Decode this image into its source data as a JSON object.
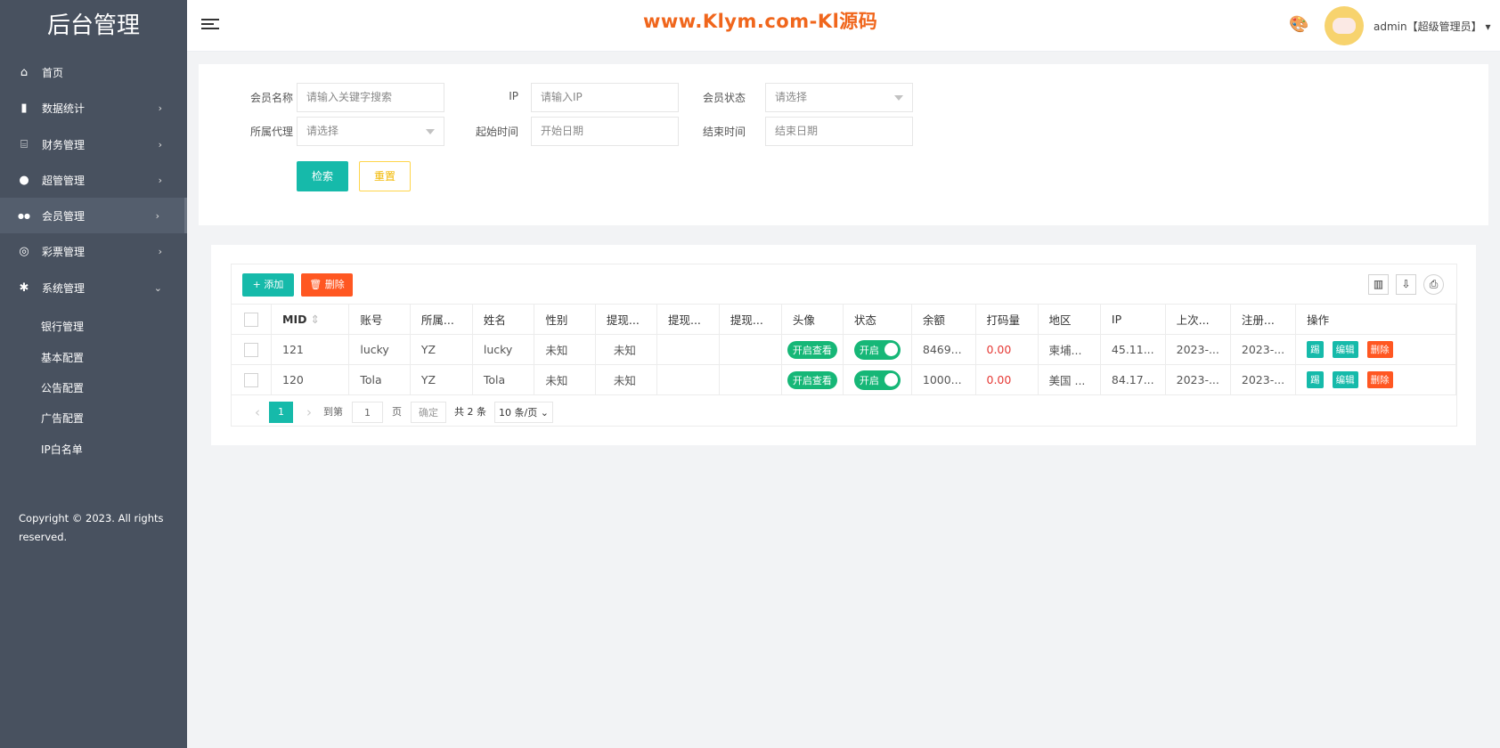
{
  "sidebar": {
    "logo": "后台管理",
    "items": [
      {
        "label": "首页",
        "icon": "home-icon",
        "glyph": "⌂"
      },
      {
        "label": "数据统计",
        "icon": "bar-chart-icon",
        "glyph": "▮",
        "arrow": "›"
      },
      {
        "label": "财务管理",
        "icon": "bank-icon",
        "glyph": "⌸",
        "arrow": "›"
      },
      {
        "label": "超管管理",
        "icon": "user-icon",
        "glyph": "●",
        "arrow": "›"
      },
      {
        "label": "会员管理",
        "icon": "users-icon",
        "glyph": "●●",
        "arrow": "›"
      },
      {
        "label": "彩票管理",
        "icon": "gamepad-icon",
        "glyph": "◎",
        "arrow": "›"
      },
      {
        "label": "系统管理",
        "icon": "gear-icon",
        "glyph": "✱",
        "arrow": "⌄"
      }
    ],
    "sub_items": [
      "银行管理",
      "基本配置",
      "公告配置",
      "广告配置",
      "IP白名单"
    ],
    "copyright": "Copyright © 2023. All rights reserved."
  },
  "header": {
    "watermark": "www.Klym.com-Kl源码",
    "user": "admin【超级管理员】",
    "caret": "▾",
    "palette_glyph": "🎨"
  },
  "filters": {
    "member_name": {
      "label": "会员名称",
      "placeholder": "请输入关键字搜索"
    },
    "ip": {
      "label": "IP",
      "placeholder": "请输入IP"
    },
    "status": {
      "label": "会员状态",
      "value": "请选择"
    },
    "agent": {
      "label": "所属代理",
      "value": "请选择"
    },
    "start": {
      "label": "起始时间",
      "placeholder": "开始日期"
    },
    "end": {
      "label": "结束时间",
      "placeholder": "结束日期"
    },
    "search_label": "检索",
    "reset_label": "重置"
  },
  "toolbar": {
    "add_label": "+ 添加",
    "delete_label": "🗑 删除",
    "columns_glyph": "▥",
    "export_glyph": "⇩",
    "print_glyph": "⎙"
  },
  "table": {
    "columns": [
      "",
      "MID",
      "账号",
      "所属...",
      "姓名",
      "性别",
      "提现...",
      "提现...",
      "提现...",
      "头像",
      "状态",
      "余额",
      "打码量",
      "地区",
      "IP",
      "上次...",
      "注册...",
      "操作"
    ],
    "sort_glyph": "⇕",
    "rows": [
      {
        "mid": "121",
        "account": "lucky",
        "agent": "YZ",
        "name": "lucky",
        "gender": "未知",
        "w1": "未知",
        "w2": "",
        "w3": "",
        "avatar": "开启查看",
        "status": "开启",
        "balance": "8469...",
        "bet": "0.00",
        "region": "柬埔...",
        "ip": "45.11...",
        "last": "2023-...",
        "reg": "2023-..."
      },
      {
        "mid": "120",
        "account": "Tola",
        "agent": "YZ",
        "name": "Tola",
        "gender": "未知",
        "w1": "未知",
        "w2": "",
        "w3": "",
        "avatar": "开启查看",
        "status": "开启",
        "balance": "1000...",
        "bet": "0.00",
        "region": "美国 ...",
        "ip": "84.17...",
        "last": "2023-...",
        "reg": "2023-..."
      }
    ],
    "actions": [
      "踢",
      "编辑",
      "删除"
    ]
  },
  "pager": {
    "prev": "‹",
    "current": "1",
    "next": "›",
    "goto": "到第",
    "page_input": "1",
    "page_unit": "页",
    "confirm": "确定",
    "total": "共 2 条",
    "per_page": "10 条/页 ⌄"
  },
  "colors": {
    "sidebar": "#48515f",
    "primary": "#16baaa",
    "danger": "#ff5722",
    "success": "#16b777",
    "watermark": "#f0661c"
  }
}
